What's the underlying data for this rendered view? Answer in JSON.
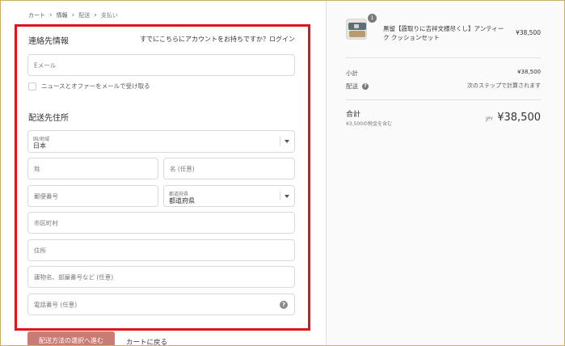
{
  "breadcrumb": {
    "items": [
      "カート",
      "情報",
      "配送",
      "支払い"
    ],
    "separator": "›"
  },
  "contact": {
    "title": "連絡先情報",
    "login_prompt": "すでにこちらにアカウントをお持ちですか？",
    "login_link": "ログイン",
    "email_placeholder": "Eメール",
    "newsletter_label": "ニュースとオファーをメールで受け取る"
  },
  "shipping": {
    "title": "配送先住所",
    "country_label": "国/地域",
    "country_value": "日本",
    "last_name_placeholder": "姓",
    "first_name_placeholder": "名 (任意)",
    "postal_placeholder": "郵便番号",
    "prefecture_label": "都道府県",
    "prefecture_value": "都道府県",
    "city_placeholder": "市区町村",
    "address_placeholder": "住所",
    "building_placeholder": "建物名、部屋番号など (任意)",
    "phone_placeholder": "電話番号 (任意)",
    "help_symbol": "?"
  },
  "actions": {
    "continue_label": "配送方法の選択へ進む",
    "back_label": "カートに戻る"
  },
  "summary": {
    "item": {
      "quantity": "1",
      "name": "黒留【霞取りに吉祥文様尽くし】アンティーク クッションセット",
      "price": "¥38,500"
    },
    "subtotal_label": "小計",
    "subtotal_value": "¥38,500",
    "shipping_label": "配送",
    "shipping_value": "次のステップで計算されます",
    "help_symbol": "?",
    "total_label": "合計",
    "tax_note": "¥3,500の税金を含む",
    "currency": "JPY",
    "total_value": "¥38,500"
  },
  "colors": {
    "highlight_border": "#e0151a",
    "primary_button": "#c97b76",
    "frame_border": "#c9ad6b"
  }
}
